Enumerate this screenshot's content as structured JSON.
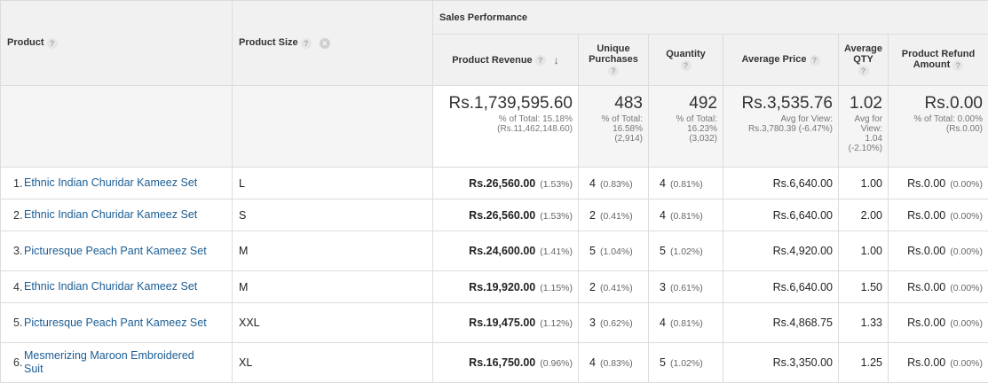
{
  "headers": {
    "product": "Product",
    "product_size": "Product Size",
    "group": "Sales Performance",
    "product_revenue": "Product Revenue",
    "unique_purchases_l1": "Unique",
    "unique_purchases_l2": "Purchases",
    "quantity": "Quantity",
    "average_price": "Average Price",
    "average_qty_l1": "Average",
    "average_qty_l2": "QTY",
    "product_refund_l1": "Product Refund",
    "product_refund_l2": "Amount",
    "help_glyph": "?",
    "remove_glyph": "×",
    "sort_glyph": "↓"
  },
  "summary": {
    "revenue": "Rs.1,739,595.60",
    "revenue_sub1": "% of Total: 15.18%",
    "revenue_sub2": "(Rs.11,462,148.60)",
    "unique": "483",
    "unique_sub1": "% of Total:",
    "unique_sub2": "16.58%",
    "unique_sub3": "(2,914)",
    "quantity": "492",
    "quantity_sub1": "% of Total:",
    "quantity_sub2": "16.23%",
    "quantity_sub3": "(3,032)",
    "avg_price": "Rs.3,535.76",
    "avg_price_sub1": "Avg for View:",
    "avg_price_sub2": "Rs.3,780.39 (-6.47%)",
    "avg_qty": "1.02",
    "avg_qty_sub1": "Avg for",
    "avg_qty_sub2": "View:",
    "avg_qty_sub3": "1.04",
    "avg_qty_sub4": "(-2.10%)",
    "refund": "Rs.0.00",
    "refund_sub1": "% of Total: 0.00%",
    "refund_sub2": "(Rs.0.00)"
  },
  "rows": [
    {
      "rank": "1.",
      "product": "Ethnic Indian Churidar Kameez Set",
      "size": "L",
      "revenue": "Rs.26,560.00",
      "revenue_pct": "(1.53%)",
      "unique": "4",
      "unique_pct": "(0.83%)",
      "quantity": "4",
      "quantity_pct": "(0.81%)",
      "avg_price": "Rs.6,640.00",
      "avg_qty": "1.00",
      "refund": "Rs.0.00",
      "refund_pct": "(0.00%)"
    },
    {
      "rank": "2.",
      "product": "Ethnic Indian Churidar Kameez Set",
      "size": "S",
      "revenue": "Rs.26,560.00",
      "revenue_pct": "(1.53%)",
      "unique": "2",
      "unique_pct": "(0.41%)",
      "quantity": "4",
      "quantity_pct": "(0.81%)",
      "avg_price": "Rs.6,640.00",
      "avg_qty": "2.00",
      "refund": "Rs.0.00",
      "refund_pct": "(0.00%)"
    },
    {
      "rank": "3.",
      "product": "Picturesque Peach Pant Kameez Set",
      "size": "M",
      "revenue": "Rs.24,600.00",
      "revenue_pct": "(1.41%)",
      "unique": "5",
      "unique_pct": "(1.04%)",
      "quantity": "5",
      "quantity_pct": "(1.02%)",
      "avg_price": "Rs.4,920.00",
      "avg_qty": "1.00",
      "refund": "Rs.0.00",
      "refund_pct": "(0.00%)"
    },
    {
      "rank": "4.",
      "product": "Ethnic Indian Churidar Kameez Set",
      "size": "M",
      "revenue": "Rs.19,920.00",
      "revenue_pct": "(1.15%)",
      "unique": "2",
      "unique_pct": "(0.41%)",
      "quantity": "3",
      "quantity_pct": "(0.61%)",
      "avg_price": "Rs.6,640.00",
      "avg_qty": "1.50",
      "refund": "Rs.0.00",
      "refund_pct": "(0.00%)"
    },
    {
      "rank": "5.",
      "product": "Picturesque Peach Pant Kameez Set",
      "size": "XXL",
      "revenue": "Rs.19,475.00",
      "revenue_pct": "(1.12%)",
      "unique": "3",
      "unique_pct": "(0.62%)",
      "quantity": "4",
      "quantity_pct": "(0.81%)",
      "avg_price": "Rs.4,868.75",
      "avg_qty": "1.33",
      "refund": "Rs.0.00",
      "refund_pct": "(0.00%)"
    },
    {
      "rank": "6.",
      "product": "Mesmerizing Maroon Embroidered Suit",
      "size": "XL",
      "revenue": "Rs.16,750.00",
      "revenue_pct": "(0.96%)",
      "unique": "4",
      "unique_pct": "(0.83%)",
      "quantity": "5",
      "quantity_pct": "(1.02%)",
      "avg_price": "Rs.3,350.00",
      "avg_qty": "1.25",
      "refund": "Rs.0.00",
      "refund_pct": "(0.00%)"
    }
  ]
}
